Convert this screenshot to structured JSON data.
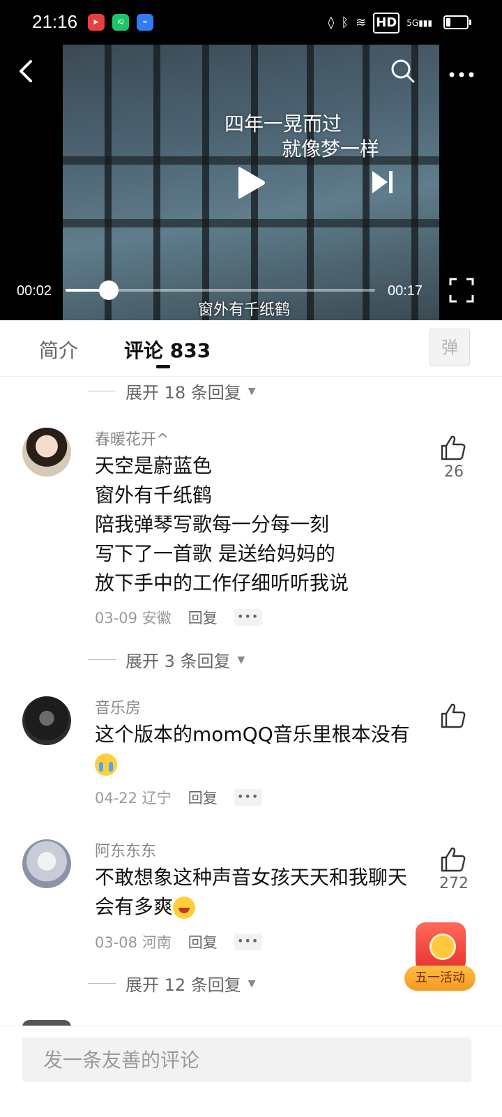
{
  "status_bar": {
    "time": "21:16",
    "apps": [
      "video-record",
      "iqiyi",
      "infinity"
    ],
    "hd": "HD",
    "network": "5G",
    "battery_percent": 20
  },
  "video": {
    "lyric_line1": "四年一晃而过",
    "lyric_line2": "就像梦一样",
    "subtitle": "窗外有千纸鹤",
    "current_time": "00:02",
    "total_time": "00:17",
    "progress_fraction": 0.14
  },
  "tabs": {
    "intro": "简介",
    "comments": "评论 833",
    "danmaku": "弹"
  },
  "expand_top": "展开 18 条回复",
  "comments": [
    {
      "user": "春暖花开^",
      "text": "天空是蔚蓝色\n窗外有千纸鹤\n陪我弹琴写歌每一分每一刻\n写下了一首歌 是送给妈妈的\n放下手中的工作仔细听听我说",
      "date": "03-09 安徽",
      "reply": "回复",
      "likes": "26",
      "expand": "展开 3 条回复"
    },
    {
      "user": "音乐房",
      "text": "这个版本的momQQ音乐里根本没有",
      "date": "04-22 辽宁",
      "reply": "回复",
      "likes": ""
    },
    {
      "user": "阿东东东",
      "text_line1": "不敢想象这种声音女孩天天和我聊天",
      "text_line2": "会有多爽",
      "date": "03-08 河南",
      "reply": "回复",
      "likes": "272",
      "expand": "展开 12 条回复"
    }
  ],
  "promo_label": "五一活动",
  "input_placeholder": "发一条友善的评论"
}
